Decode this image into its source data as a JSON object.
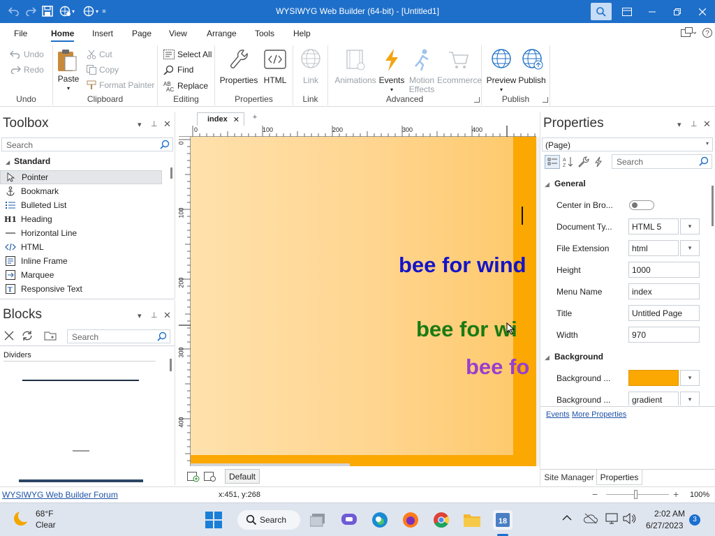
{
  "window": {
    "title": "WYSIWYG Web Builder (64-bit) - [Untitled1]"
  },
  "menu": {
    "tabs": [
      "File",
      "Home",
      "Insert",
      "Page",
      "View",
      "Arrange",
      "Tools",
      "Help"
    ],
    "active": "Home"
  },
  "ribbon": {
    "undo": {
      "undo": "Undo",
      "redo": "Redo",
      "group": "Undo"
    },
    "clipboard": {
      "paste": "Paste",
      "cut": "Cut",
      "copy": "Copy",
      "format_painter": "Format Painter",
      "group": "Clipboard"
    },
    "editing": {
      "select_all": "Select All",
      "find": "Find",
      "replace": "Replace",
      "group": "Editing"
    },
    "properties": {
      "properties": "Properties",
      "html": "HTML",
      "group": "Properties"
    },
    "link": {
      "link": "Link",
      "group": "Link"
    },
    "advanced": {
      "animations": "Animations",
      "events": "Events",
      "motion_effects_1": "Motion",
      "motion_effects_2": "Effects",
      "ecommerce": "Ecommerce",
      "group": "Advanced"
    },
    "publish": {
      "preview": "Preview",
      "publish": "Publish",
      "group": "Publish"
    }
  },
  "toolbox": {
    "title": "Toolbox",
    "search_placeholder": "Search",
    "category": "Standard",
    "items": [
      {
        "label": "Pointer",
        "icon": "pointer-icon"
      },
      {
        "label": "Bookmark",
        "icon": "anchor-icon"
      },
      {
        "label": "Bulleted List",
        "icon": "bulleted-list-icon"
      },
      {
        "label": "Heading",
        "icon": "heading-icon",
        "glyph": "H1"
      },
      {
        "label": "Horizontal Line",
        "icon": "horizontal-line-icon"
      },
      {
        "label": "HTML",
        "icon": "html-code-icon"
      },
      {
        "label": "Inline Frame",
        "icon": "inline-frame-icon"
      },
      {
        "label": "Marquee",
        "icon": "marquee-icon"
      },
      {
        "label": "Responsive Text",
        "icon": "responsive-text-icon"
      }
    ]
  },
  "blocks": {
    "title": "Blocks",
    "search_placeholder": "Search",
    "category": "Dividers"
  },
  "document": {
    "tab": "index",
    "ruler_h": [
      "0",
      "100",
      "200",
      "300",
      "400"
    ],
    "ruler_v": [
      "0",
      "100",
      "200",
      "300",
      "400"
    ],
    "texts": [
      {
        "text": "bee for wind",
        "color": "#1414c8"
      },
      {
        "text": "bee for wi",
        "color": "#1b7a12"
      },
      {
        "text": "bee fo",
        "color": "#9a3fcf"
      }
    ],
    "page_bg": "#fba802",
    "layout_label": "Default"
  },
  "properties": {
    "title": "Properties",
    "object": "(Page)",
    "search_placeholder": "Search",
    "sections": {
      "general": "General",
      "background": "Background"
    },
    "rows": [
      {
        "label": "Center in Bro...",
        "type": "toggle",
        "value": "off"
      },
      {
        "label": "Document Ty...",
        "type": "dropdown",
        "value": "HTML 5"
      },
      {
        "label": "File Extension",
        "type": "dropdown",
        "value": "html"
      },
      {
        "label": "Height",
        "type": "text",
        "value": "1000"
      },
      {
        "label": "Menu Name",
        "type": "text",
        "value": "index"
      },
      {
        "label": "Title",
        "type": "text",
        "value": "Untitled Page"
      },
      {
        "label": "Width",
        "type": "text",
        "value": "970"
      }
    ],
    "bg_rows": [
      {
        "label": "Background ...",
        "type": "color",
        "value": "#fba802"
      },
      {
        "label": "Background ...",
        "type": "dropdown",
        "value": "gradient"
      }
    ],
    "links": {
      "events": "Events",
      "more": "More Properties"
    },
    "bottom_tabs": [
      "Site Manager",
      "Properties"
    ]
  },
  "status": {
    "link": "WYSIWYG Web Builder Forum",
    "coords": "x:451, y:268",
    "zoom": "100%"
  },
  "taskbar": {
    "weather": {
      "temp": "68°F",
      "desc": "Clear"
    },
    "search_label": "Search",
    "time": "2:02 AM",
    "date": "6/27/2023",
    "notification_count": "3"
  },
  "colors": {
    "accent": "#1e6fc9",
    "page_orange": "#fba802"
  }
}
